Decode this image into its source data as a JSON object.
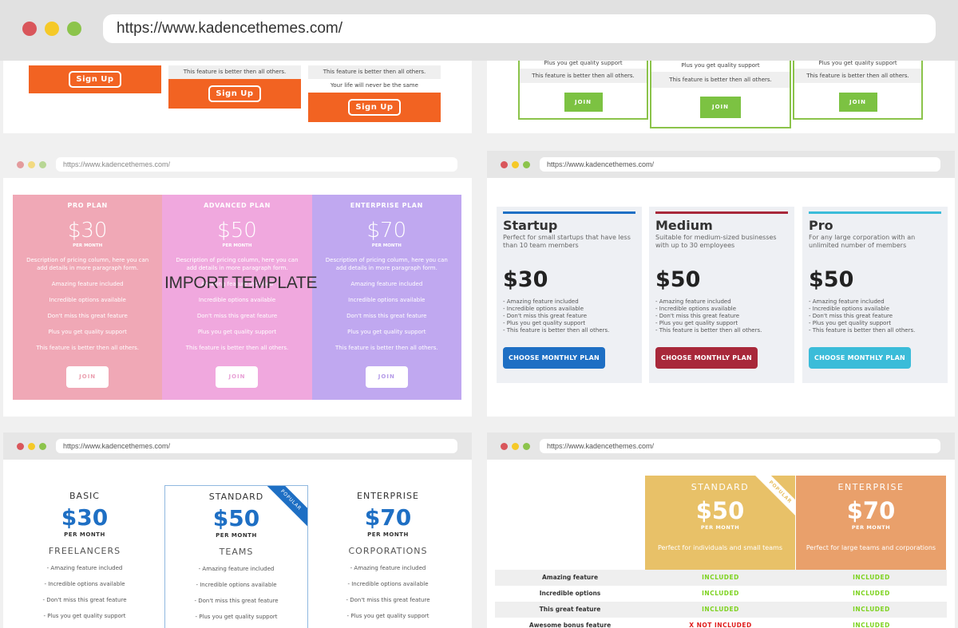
{
  "browser": {
    "url": "https://www.kadencethemes.com/",
    "dots": [
      "#d9565b",
      "#f5c928",
      "#8cc44b"
    ]
  },
  "panels": {
    "orange": {
      "accent": "#f26322",
      "col1": {
        "button": "Sign Up"
      },
      "col2": {
        "feature": "This feature is better then all others.",
        "button": "Sign Up"
      },
      "col3": {
        "feature1": "This feature is better then all others.",
        "feature2": "Your life will never be the same",
        "button": "Sign Up"
      }
    },
    "green": {
      "accent": "#7cc242",
      "columns": [
        {
          "f1": "Plus you get quality support",
          "f2": "This feature is better then all others.",
          "button": "JOIN"
        },
        {
          "f1": "Plus you get quality support",
          "f2": "This feature is better then all others.",
          "button": "JOIN"
        },
        {
          "f1": "Plus you get quality support",
          "f2": "This feature is better then all others.",
          "button": "JOIN"
        }
      ]
    },
    "pastel": {
      "url": "https://www.kadencethemes.com/",
      "overlay": "IMPORT TEMPLATE",
      "columns": [
        {
          "name": "PRO PLAN",
          "price": "$30",
          "per": "PER MONTH",
          "color": "#f0a8b6",
          "btn_color": "#eba0b0",
          "desc": "Description of pricing column, here you can add details in more paragraph form.",
          "features": [
            "Amazing feature included",
            "Incredible options available",
            "Don't miss this great feature",
            "Plus you get quality support",
            "This feature is better then all others."
          ],
          "button": "JOIN"
        },
        {
          "name": "ADVANCED PLAN",
          "price": "$50",
          "per": "PER MONTH",
          "color": "#f0a8de",
          "btn_color": "#e8a0d6",
          "desc": "Description of pricing column, here you can add details in more paragraph form.",
          "features": [
            "Amazing feature included",
            "Incredible options available",
            "Don't miss this great feature",
            "Plus you get quality support",
            "This feature is better then all others."
          ],
          "button": "JOIN"
        },
        {
          "name": "ENTERPRISE PLAN",
          "price": "$70",
          "per": "PER MONTH",
          "color": "#c0a8f0",
          "btn_color": "#b49ae8",
          "desc": "Description of pricing column, here you can add details in more paragraph form.",
          "features": [
            "Amazing feature included",
            "Incredible options available",
            "Don't miss this great feature",
            "Plus you get quality support",
            "This feature is better then all others."
          ],
          "button": "JOIN"
        }
      ]
    },
    "business": {
      "url": "https://www.kadencethemes.com/",
      "cards": [
        {
          "name": "Startup",
          "desc": "Perfect for small startups that have less than 10 team members",
          "price": "$30",
          "color": "#1e6fc4",
          "features": [
            "- Amazing feature included",
            "- Incredible options available",
            "- Don't miss this great feature",
            "- Plus you get quality support",
            "- This feature is better then all others."
          ],
          "button": "CHOOSE MONTHLY PLAN"
        },
        {
          "name": "Medium",
          "desc": "Suitable for medium-sized businesses with up to 30 employees",
          "price": "$50",
          "color": "#a8283a",
          "features": [
            "- Amazing feature included",
            "- Incredible options available",
            "- Don't miss this great feature",
            "- Plus you get quality support",
            "- This feature is better then all others."
          ],
          "button": "CHOOSE MONTHLY PLAN"
        },
        {
          "name": "Pro",
          "desc": "For any large corporation with an unlimited number of members",
          "price": "$50",
          "color": "#3bbcd9",
          "features": [
            "- Amazing feature included",
            "- Incredible options available",
            "- Don't miss this great feature",
            "- Plus you get quality support",
            "- This feature is better then all others."
          ],
          "button": "CHOOSE MONTHLY PLAN"
        }
      ]
    },
    "blue": {
      "url": "https://www.kadencethemes.com/",
      "ribbon": "POPULAR",
      "columns": [
        {
          "name": "BASIC",
          "price": "$30",
          "per": "PER MONTH",
          "audience": "FREELANCERS",
          "features": [
            "- Amazing feature included",
            "- Incredible options available",
            "- Don't miss this great feature",
            "- Plus you get quality support"
          ]
        },
        {
          "name": "STANDARD",
          "price": "$50",
          "per": "PER MONTH",
          "audience": "TEAMS",
          "features": [
            "- Amazing feature included",
            "- Incredible options available",
            "- Don't miss this great feature",
            "- Plus you get quality support"
          ]
        },
        {
          "name": "ENTERPRISE",
          "price": "$70",
          "per": "PER MONTH",
          "audience": "CORPORATIONS",
          "features": [
            "- Amazing feature included",
            "- Incredible options available",
            "- Don't miss this great feature",
            "- Plus you get quality support"
          ]
        }
      ]
    },
    "table": {
      "url": "https://www.kadencethemes.com/",
      "ribbon": "POPULAR",
      "plans": [
        {
          "name": "STANDARD",
          "price": "$50",
          "per": "PER MONTH",
          "desc": "Perfect for individuals and small teams",
          "color": "#e8c168"
        },
        {
          "name": "ENTERPRISE",
          "price": "$70",
          "per": "PER MONTH",
          "desc": "Perfect for large teams and corporations",
          "color": "#e9a06b"
        }
      ],
      "rows": [
        {
          "feature": "Amazing feature",
          "standard": "INCLUDED",
          "enterprise": "INCLUDED"
        },
        {
          "feature": "Incredible options",
          "standard": "INCLUDED",
          "enterprise": "INCLUDED"
        },
        {
          "feature": "This great feature",
          "standard": "INCLUDED",
          "enterprise": "INCLUDED"
        },
        {
          "feature": "Awesome bonus feature",
          "standard": "X NOT INCLUDED",
          "enterprise": "INCLUDED"
        }
      ]
    }
  }
}
